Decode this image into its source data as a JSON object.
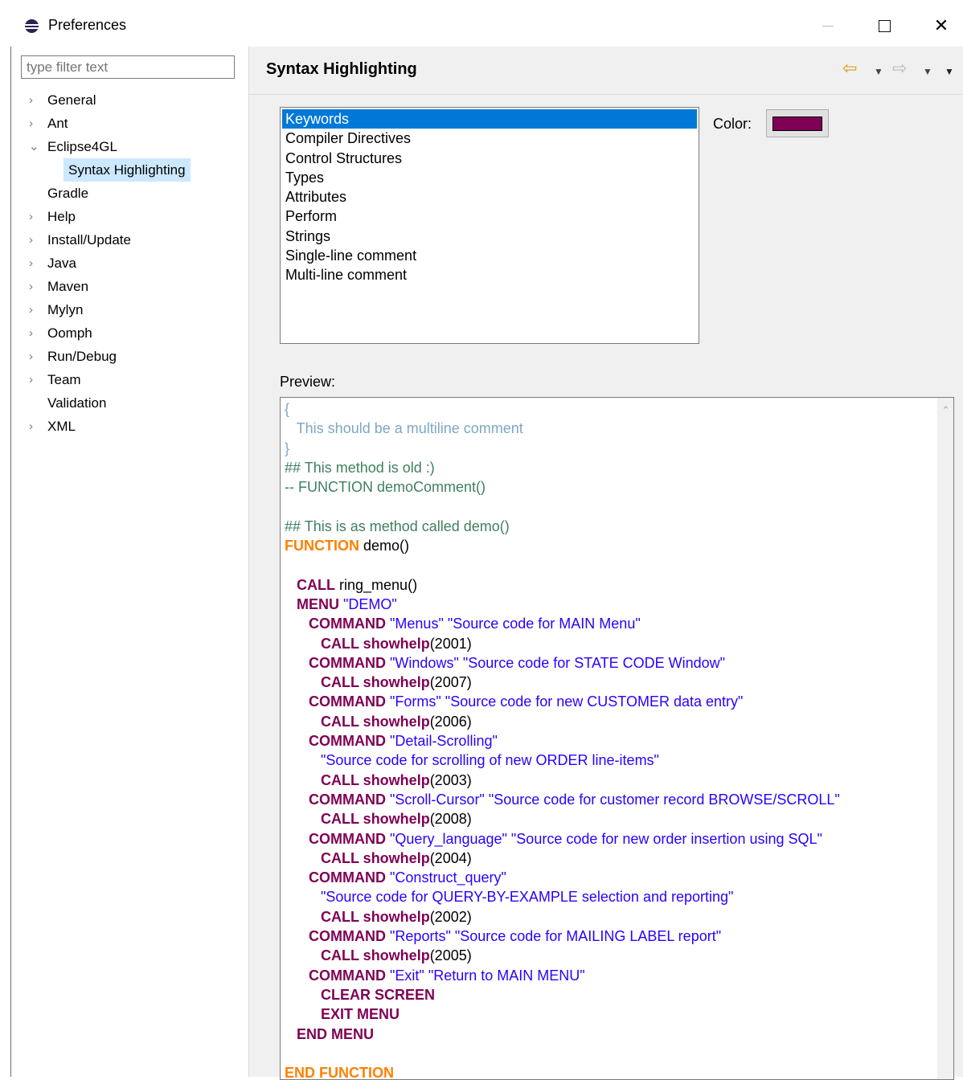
{
  "window": {
    "title": "Preferences",
    "minimize_glyph": "",
    "close_glyph": "✕"
  },
  "filter": {
    "placeholder": "type filter text"
  },
  "tree": [
    {
      "label": "General",
      "chevron": "›"
    },
    {
      "label": "Ant",
      "chevron": "›"
    },
    {
      "label": "Eclipse4GL",
      "chevron": "⌄"
    },
    {
      "label": "Syntax Highlighting",
      "chevron": "",
      "child": true,
      "selected": true
    },
    {
      "label": "Gradle",
      "chevron": ""
    },
    {
      "label": "Help",
      "chevron": "›"
    },
    {
      "label": "Install/Update",
      "chevron": "›"
    },
    {
      "label": "Java",
      "chevron": "›"
    },
    {
      "label": "Maven",
      "chevron": "›"
    },
    {
      "label": "Mylyn",
      "chevron": "›"
    },
    {
      "label": "Oomph",
      "chevron": "›"
    },
    {
      "label": "Run/Debug",
      "chevron": "›"
    },
    {
      "label": "Team",
      "chevron": "›"
    },
    {
      "label": "Validation",
      "chevron": ""
    },
    {
      "label": "XML",
      "chevron": "›"
    }
  ],
  "page": {
    "title": "Syntax Highlighting",
    "nav_back_icon": "⇦",
    "nav_fwd_icon": "⇨",
    "dropdown_icon": "▼"
  },
  "elements": {
    "items": [
      "Keywords",
      "Compiler Directives",
      "Control Structures",
      "Types",
      "Attributes",
      "Perform",
      "Strings",
      "Single-line comment",
      "Multi-line comment"
    ],
    "selected_index": 0
  },
  "color": {
    "label": "Color:",
    "value": "#7f0055"
  },
  "preview": {
    "label": "Preview:",
    "lines": [
      [
        [
          "mlc",
          "{"
        ]
      ],
      [
        [
          "mlc",
          "   This should be a multiline comment"
        ]
      ],
      [
        [
          "mlc",
          "}"
        ]
      ],
      [
        [
          "slc",
          "## This method is old :)"
        ]
      ],
      [
        [
          "slc",
          "-- FUNCTION demoComment()"
        ]
      ],
      [],
      [
        [
          "slc",
          "## This is as method called demo()"
        ]
      ],
      [
        [
          "fn",
          "FUNCTION"
        ],
        [
          "",
          " demo()"
        ]
      ],
      [],
      [
        [
          "",
          "   "
        ],
        [
          "kw",
          "CALL"
        ],
        [
          "",
          " ring_menu()"
        ]
      ],
      [
        [
          "",
          "   "
        ],
        [
          "kw",
          "MENU"
        ],
        [
          "",
          " "
        ],
        [
          "str",
          "\"DEMO\""
        ]
      ],
      [
        [
          "",
          "      "
        ],
        [
          "kw",
          "COMMAND"
        ],
        [
          "",
          " "
        ],
        [
          "str",
          "\"Menus\" \"Source code for MAIN Menu\""
        ]
      ],
      [
        [
          "",
          "         "
        ],
        [
          "kw",
          "CALL showhelp"
        ],
        [
          "",
          "(2001)"
        ]
      ],
      [
        [
          "",
          "      "
        ],
        [
          "kw",
          "COMMAND"
        ],
        [
          "",
          " "
        ],
        [
          "str",
          "\"Windows\" \"Source code for STATE CODE Window\""
        ]
      ],
      [
        [
          "",
          "         "
        ],
        [
          "kw",
          "CALL showhelp"
        ],
        [
          "",
          "(2007)"
        ]
      ],
      [
        [
          "",
          "      "
        ],
        [
          "kw",
          "COMMAND"
        ],
        [
          "",
          " "
        ],
        [
          "str",
          "\"Forms\" \"Source code for new CUSTOMER data entry\""
        ]
      ],
      [
        [
          "",
          "         "
        ],
        [
          "kw",
          "CALL showhelp"
        ],
        [
          "",
          "(2006)"
        ]
      ],
      [
        [
          "",
          "      "
        ],
        [
          "kw",
          "COMMAND"
        ],
        [
          "",
          " "
        ],
        [
          "str",
          "\"Detail-Scrolling\""
        ]
      ],
      [
        [
          "",
          "         "
        ],
        [
          "str",
          "\"Source code for scrolling of new ORDER line-items\""
        ]
      ],
      [
        [
          "",
          "         "
        ],
        [
          "kw",
          "CALL showhelp"
        ],
        [
          "",
          "(2003)"
        ]
      ],
      [
        [
          "",
          "      "
        ],
        [
          "kw",
          "COMMAND"
        ],
        [
          "",
          " "
        ],
        [
          "str",
          "\"Scroll-Cursor\" \"Source code for customer record BROWSE/SCROLL\""
        ]
      ],
      [
        [
          "",
          "         "
        ],
        [
          "kw",
          "CALL showhelp"
        ],
        [
          "",
          "(2008)"
        ]
      ],
      [
        [
          "",
          "      "
        ],
        [
          "kw",
          "COMMAND"
        ],
        [
          "",
          " "
        ],
        [
          "str",
          "\"Query_language\" \"Source code for new order insertion using SQL\""
        ]
      ],
      [
        [
          "",
          "         "
        ],
        [
          "kw",
          "CALL showhelp"
        ],
        [
          "",
          "(2004)"
        ]
      ],
      [
        [
          "",
          "      "
        ],
        [
          "kw",
          "COMMAND"
        ],
        [
          "",
          " "
        ],
        [
          "str",
          "\"Construct_query\""
        ]
      ],
      [
        [
          "",
          "         "
        ],
        [
          "str",
          "\"Source code for QUERY-BY-EXAMPLE selection and reporting\""
        ]
      ],
      [
        [
          "",
          "         "
        ],
        [
          "kw",
          "CALL showhelp"
        ],
        [
          "",
          "(2002)"
        ]
      ],
      [
        [
          "",
          "      "
        ],
        [
          "kw",
          "COMMAND"
        ],
        [
          "",
          " "
        ],
        [
          "str",
          "\"Reports\" \"Source code for MAILING LABEL report\""
        ]
      ],
      [
        [
          "",
          "         "
        ],
        [
          "kw",
          "CALL showhelp"
        ],
        [
          "",
          "(2005)"
        ]
      ],
      [
        [
          "",
          "      "
        ],
        [
          "kw",
          "COMMAND"
        ],
        [
          "",
          " "
        ],
        [
          "str",
          "\"Exit\" \"Return to MAIN MENU\""
        ]
      ],
      [
        [
          "",
          "         "
        ],
        [
          "kw",
          "CLEAR SCREEN"
        ]
      ],
      [
        [
          "",
          "         "
        ],
        [
          "kw",
          "EXIT MENU"
        ]
      ],
      [
        [
          "",
          "   "
        ],
        [
          "kw",
          "END MENU"
        ]
      ],
      [],
      [
        [
          "fn",
          "END FUNCTION"
        ]
      ]
    ]
  }
}
